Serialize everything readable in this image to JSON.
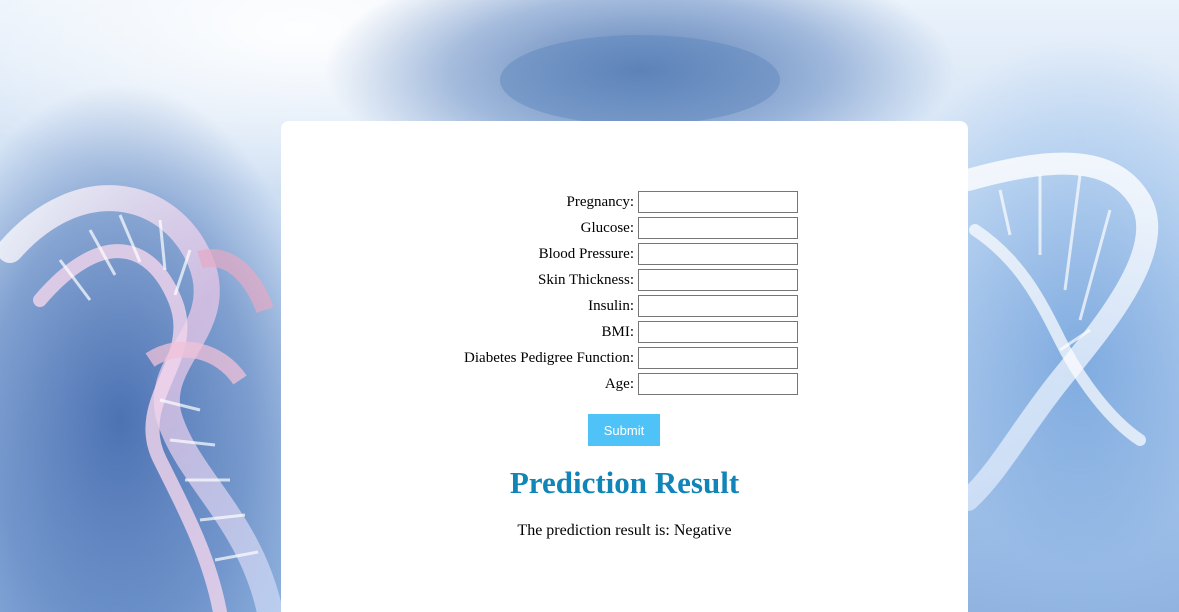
{
  "form": {
    "fields": [
      {
        "label": "Pregnancy:",
        "value": ""
      },
      {
        "label": "Glucose:",
        "value": ""
      },
      {
        "label": "Blood Pressure:",
        "value": ""
      },
      {
        "label": "Skin Thickness:",
        "value": ""
      },
      {
        "label": "Insulin:",
        "value": ""
      },
      {
        "label": "BMI:",
        "value": ""
      },
      {
        "label": "Diabetes Pedigree Function:",
        "value": ""
      },
      {
        "label": "Age:",
        "value": ""
      }
    ],
    "submit_label": "Submit"
  },
  "result": {
    "title": "Prediction Result",
    "text": "The prediction result is: Negative"
  },
  "colors": {
    "accent": "#4fc3f7",
    "title": "#1185b8",
    "card": "#ffffff"
  }
}
